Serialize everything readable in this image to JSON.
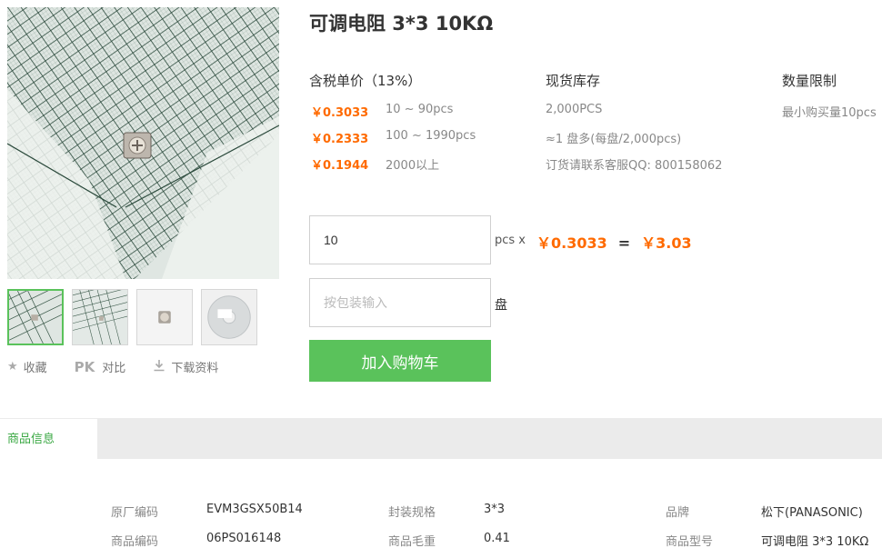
{
  "product": {
    "title": "可调电阻 3*3 10KΩ"
  },
  "gallery": {
    "thumbnails": [
      "ruler-closeup",
      "ruler-wide",
      "component-top",
      "reel-packaging"
    ]
  },
  "actions": {
    "favorite": "收藏",
    "compare_prefix": "PK",
    "compare": "对比",
    "download": "下载资料"
  },
  "pricing": {
    "header_price": "含税单价（13%）",
    "header_stock": "现货库存",
    "header_limit": "数量限制",
    "tiers": [
      {
        "price": "￥0.3033",
        "range": "10 ~ 90pcs"
      },
      {
        "price": "￥0.2333",
        "range": "100 ~ 1990pcs"
      },
      {
        "price": "￥0.1944",
        "range": "2000以上"
      }
    ],
    "stock_lines": [
      "2,000PCS",
      "≈1 盘多(每盘/2,000pcs)",
      "订货请联系客服QQ: 800158062"
    ],
    "limit": "最小购买量10pcs"
  },
  "order": {
    "quantity_value": "10",
    "quantity_unit": "pcs x",
    "unit_price": "￥0.3033",
    "equals": "=",
    "total": "￥3.03",
    "reel_placeholder": "按包装输入",
    "reel_unit": "盘",
    "add_to_cart": "加入购物车"
  },
  "tabs": {
    "product_info": "商品信息"
  },
  "specs": [
    {
      "label": "原厂编码",
      "value": "EVM3GSX50B14"
    },
    {
      "label": "封装规格",
      "value": "3*3"
    },
    {
      "label": "品牌",
      "value": "松下(PANASONIC)"
    },
    {
      "label": "商品编码",
      "value": "06PS016148"
    },
    {
      "label": "商品毛重",
      "value": "0.41"
    },
    {
      "label": "商品型号",
      "value": "可调电阻 3*3 10KΩ"
    }
  ],
  "colors": {
    "accent_green": "#5ac25b",
    "price_orange": "#ff6a00",
    "tab_text_green": "#3aa843"
  }
}
